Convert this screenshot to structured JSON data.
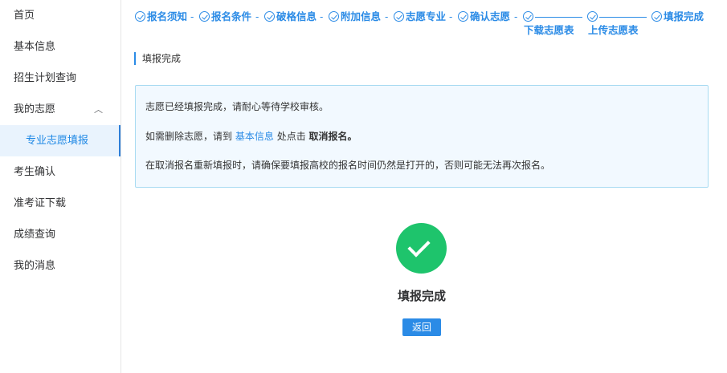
{
  "sidebar": {
    "items": [
      {
        "label": "首页"
      },
      {
        "label": "基本信息"
      },
      {
        "label": "招生计划查询"
      },
      {
        "label": "我的志愿"
      },
      {
        "label": "专业志愿填报"
      },
      {
        "label": "考生确认"
      },
      {
        "label": "准考证下载"
      },
      {
        "label": "成绩查询"
      },
      {
        "label": "我的消息"
      }
    ]
  },
  "steps": {
    "s1": "报名须知",
    "s2": "报名条件",
    "s3": "破格信息",
    "s4": "附加信息",
    "s5": "志愿专业",
    "s6": "确认志愿",
    "s7": "下载志愿表",
    "s8": "上传志愿表",
    "s9": "填报完成",
    "separator": "-"
  },
  "section": {
    "title": "填报完成"
  },
  "notice": {
    "line1": "志愿已经填报完成，请耐心等待学校审核。",
    "line2_prefix": "如需删除志愿，请到",
    "line2_link": "基本信息",
    "line2_middle": "处点击",
    "line2_bold": "取消报名。",
    "line3": "在取消报名重新填报时，请确保要填报高校的报名时间仍然是打开的，否则可能无法再次报名。"
  },
  "result": {
    "title": "填报完成",
    "back_label": "返回"
  },
  "colors": {
    "accent": "#2b8be6",
    "success": "#1ec46c",
    "notice_bg": "#f2f9ff",
    "notice_border": "#a9dbf2"
  }
}
